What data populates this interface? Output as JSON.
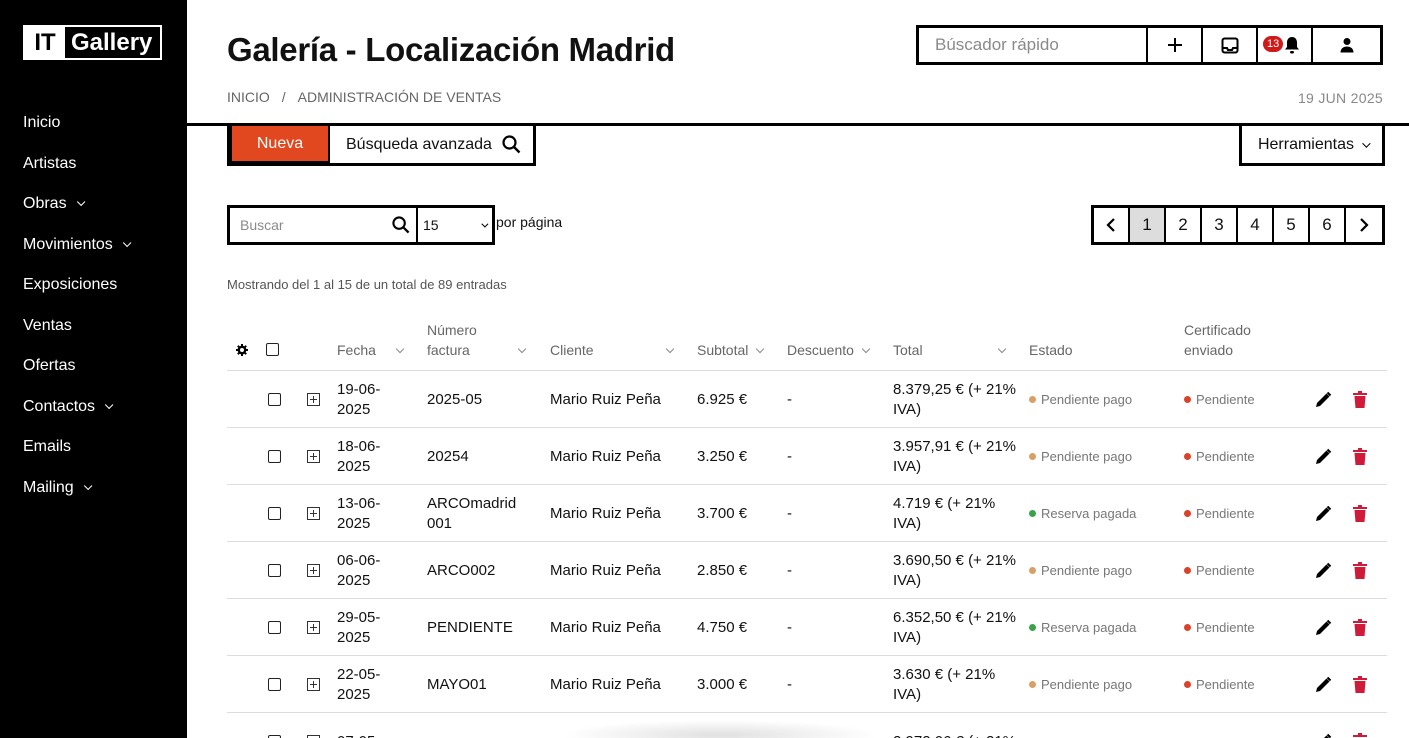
{
  "brand": {
    "it": "IT",
    "name": "Gallery"
  },
  "sidebar": {
    "items": [
      {
        "label": "Inicio",
        "has_children": false
      },
      {
        "label": "Artistas",
        "has_children": false
      },
      {
        "label": "Obras",
        "has_children": true
      },
      {
        "label": "Movimientos",
        "has_children": true
      },
      {
        "label": "Exposiciones",
        "has_children": false
      },
      {
        "label": "Ventas",
        "has_children": false
      },
      {
        "label": "Ofertas",
        "has_children": false
      },
      {
        "label": "Contactos",
        "has_children": true
      },
      {
        "label": "Emails",
        "has_children": false
      },
      {
        "label": "Mailing",
        "has_children": true
      }
    ]
  },
  "header": {
    "title": "Galería - Localización Madrid",
    "breadcrumb": [
      "INICIO",
      "/",
      "ADMINISTRACIÓN DE VENTAS"
    ],
    "date": "19 JUN 2025",
    "quick_search_placeholder": "Búscador rápido",
    "notification_count": "13",
    "icons": [
      "plus-icon",
      "inbox-icon",
      "bell-icon",
      "user-icon"
    ]
  },
  "actions": {
    "new_label": "Nueva",
    "advanced_search_label": "Búsqueda avanzada",
    "tools_label": "Herramientas"
  },
  "filter": {
    "search_placeholder": "Buscar",
    "per_page_value": "15",
    "per_page_label": "por página"
  },
  "pagination": {
    "pages": [
      "1",
      "2",
      "3",
      "4",
      "5",
      "6"
    ],
    "current": "1"
  },
  "summary": "Mostrando del 1 al 15 de un total de 89 entradas",
  "colors": {
    "accent": "#e2481f",
    "pending": "#d9a066",
    "paid": "#3aa34a",
    "cert_pending": "#d9432a",
    "delete": "#d01a3a"
  },
  "table": {
    "columns": {
      "fecha": "Fecha",
      "numero": "Número factura",
      "cliente": "Cliente",
      "subtotal": "Subtotal",
      "descuento": "Descuento",
      "total": "Total",
      "estado": "Estado",
      "certificado": "Certificado enviado"
    },
    "rows": [
      {
        "fecha": "19-06-2025",
        "numero": "2025-05",
        "cliente": "Mario Ruiz Peña",
        "subtotal": "6.925 €",
        "descuento": "-",
        "total": "8.379,25 € (+ 21% IVA)",
        "estado": "Pendiente pago",
        "estado_kind": "pending",
        "certificado": "Pendiente"
      },
      {
        "fecha": "18-06-2025",
        "numero": "20254",
        "cliente": "Mario Ruiz Peña",
        "subtotal": "3.250 €",
        "descuento": "-",
        "total": "3.957,91 € (+ 21% IVA)",
        "estado": "Pendiente pago",
        "estado_kind": "pending",
        "certificado": "Pendiente"
      },
      {
        "fecha": "13-06-2025",
        "numero": "ARCOmadrid 001",
        "cliente": "Mario Ruiz Peña",
        "subtotal": "3.700 €",
        "descuento": "-",
        "total": "4.719 € (+ 21% IVA)",
        "estado": "Reserva pagada",
        "estado_kind": "paid",
        "certificado": "Pendiente"
      },
      {
        "fecha": "06-06-2025",
        "numero": "ARCO002",
        "cliente": "Mario Ruiz Peña",
        "subtotal": "2.850 €",
        "descuento": "-",
        "total": "3.690,50 € (+ 21% IVA)",
        "estado": "Pendiente pago",
        "estado_kind": "pending",
        "certificado": "Pendiente"
      },
      {
        "fecha": "29-05-2025",
        "numero": "PENDIENTE",
        "cliente": "Mario Ruiz Peña",
        "subtotal": "4.750 €",
        "descuento": "-",
        "total": "6.352,50 € (+ 21% IVA)",
        "estado": "Reserva pagada",
        "estado_kind": "paid",
        "certificado": "Pendiente"
      },
      {
        "fecha": "22-05-2025",
        "numero": "MAYO01",
        "cliente": "Mario Ruiz Peña",
        "subtotal": "3.000 €",
        "descuento": "-",
        "total": "3.630 € (+ 21% IVA)",
        "estado": "Pendiente pago",
        "estado_kind": "pending",
        "certificado": "Pendiente"
      },
      {
        "fecha": "07-05-",
        "numero": "",
        "cliente": "",
        "subtotal": "",
        "descuento": "",
        "total": "2.972,06 € (+ 21%",
        "estado": "",
        "estado_kind": "",
        "certificado": ""
      }
    ]
  }
}
